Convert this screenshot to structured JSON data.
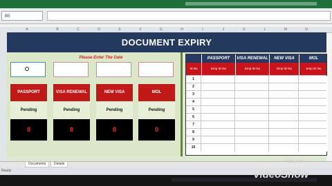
{
  "spreadsheet": {
    "name_box": "B5",
    "columns": [
      "A",
      "B",
      "C",
      "D",
      "E",
      "F",
      "G",
      "H",
      "I",
      "J",
      "K",
      "L",
      "M",
      "N"
    ],
    "title": "DOCUMENT EXPIRY",
    "date_prompt": "Please Enter The Date",
    "cards": [
      {
        "label": "PASSPORT",
        "status": "Pending",
        "count": "0"
      },
      {
        "label": "VISA RENEWAL",
        "status": "Pending",
        "count": "0"
      },
      {
        "label": "NEW VISA",
        "status": "Pending",
        "count": "0"
      },
      {
        "label": "MOL",
        "status": "Pending",
        "count": "0"
      }
    ],
    "table": {
      "headers": [
        "PASSPORT",
        "VISA RENEWAL",
        "NEW VISA",
        "MOL"
      ],
      "subheaders": [
        "Sl No",
        "Emp ID No",
        "Emp ID No",
        "Emp ID No",
        "Emp ID No"
      ],
      "rows": [
        "1",
        "2",
        "3",
        "4",
        "5",
        "6",
        "7",
        "8",
        "9",
        "10"
      ]
    },
    "tabs": [
      "Documents",
      "Details"
    ],
    "status": "Ready"
  },
  "watermark": {
    "small": "Made with",
    "large": "VideoShow"
  }
}
